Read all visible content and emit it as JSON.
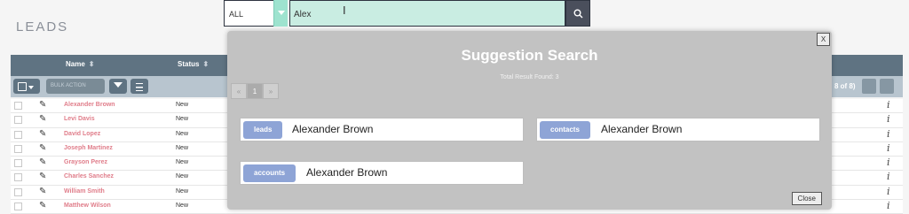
{
  "page": {
    "title": "LEADS"
  },
  "search": {
    "module_value": "ALL",
    "query_value": "Alex"
  },
  "table": {
    "headers": {
      "name": "Name",
      "status": "Status"
    },
    "bulk_action_label": "BULK ACTION",
    "pager_text": "8 of 8)",
    "rows": [
      {
        "name": "Alexander Brown",
        "status": "New"
      },
      {
        "name": "Levi Davis",
        "status": "New"
      },
      {
        "name": "David Lopez",
        "status": "New"
      },
      {
        "name": "Joseph Martinez",
        "status": "New"
      },
      {
        "name": "Grayson Perez",
        "status": "New"
      },
      {
        "name": "Charles Sanchez",
        "status": "New"
      },
      {
        "name": "William Smith",
        "status": "New"
      },
      {
        "name": "Matthew Wilson",
        "status": "New"
      }
    ]
  },
  "modal": {
    "title": "Suggestion Search",
    "total_text": "Total Result Found: 3",
    "close_x": "X",
    "close_label": "Close",
    "pagination": {
      "prev": "«",
      "current": "1",
      "next": "»"
    },
    "results": [
      {
        "module": "leads",
        "name": "Alexander Brown"
      },
      {
        "module": "contacts",
        "name": "Alexander Brown"
      },
      {
        "module": "accounts",
        "name": "Alexander Brown"
      }
    ]
  },
  "colors": {
    "header_bg": "#5f7382",
    "search_input_bg": "#c9ede2",
    "module_tag_bg": "#8ea4d6",
    "lead_link": "#e07d8a",
    "modal_bg": "#c2c2c2"
  },
  "icons": [
    "search-icon",
    "edit-icon",
    "info-icon",
    "filter-icon",
    "columns-icon",
    "text-cursor-icon",
    "sort-icon"
  ]
}
